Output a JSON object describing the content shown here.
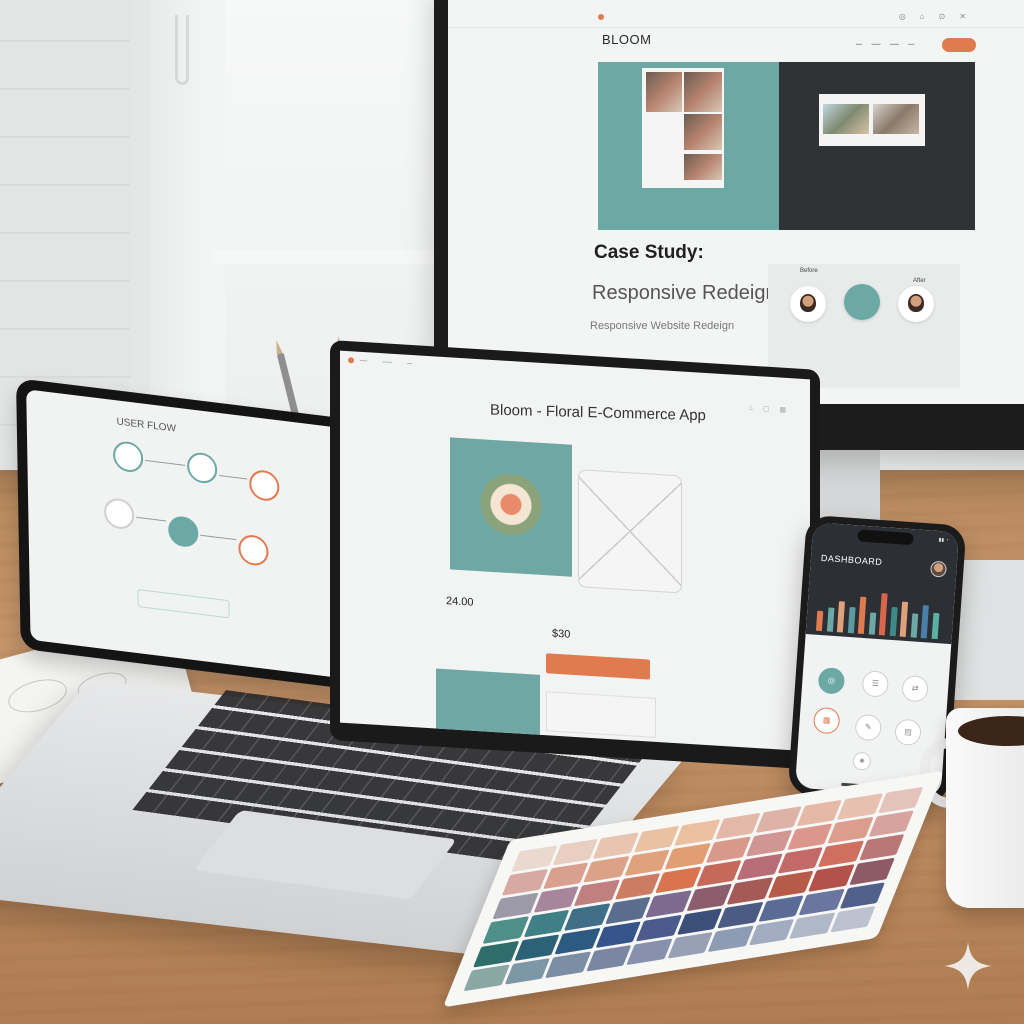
{
  "monitor": {
    "brand": "BLOOM",
    "case_title": "Case Study:",
    "case_subtitle": "Responsive Redeign",
    "case_subtitle2": "Responsive Website Redeign",
    "before_label": "Before",
    "after_label": "After"
  },
  "laptop": {
    "app_title": "Bloom - Floral E-Commerce App",
    "price_a": "24.00",
    "price_b": "$30"
  },
  "tablet": {
    "title": "USER FLOW"
  },
  "phone": {
    "title": "DASHBOARD",
    "chart_bars": [
      {
        "value": 0.45,
        "color": "#e07a4f"
      },
      {
        "value": 0.55,
        "color": "#6ca9a5"
      },
      {
        "value": 0.7,
        "color": "#e0a07a"
      },
      {
        "value": 0.6,
        "color": "#5a9aa0"
      },
      {
        "value": 0.85,
        "color": "#e07a4f"
      },
      {
        "value": 0.5,
        "color": "#6ca9a5"
      },
      {
        "value": 0.95,
        "color": "#d9654a"
      },
      {
        "value": 0.65,
        "color": "#3f8a86"
      },
      {
        "value": 0.8,
        "color": "#e0a07a"
      },
      {
        "value": 0.55,
        "color": "#6ca9a5"
      },
      {
        "value": 0.75,
        "color": "#4a7fa8"
      },
      {
        "value": 0.6,
        "color": "#5ab0a4"
      }
    ]
  },
  "swatches": [
    "#e9d9cf",
    "#e8cfc2",
    "#e7c5b1",
    "#e9c2a4",
    "#eac0a1",
    "#e4b8a8",
    "#ddb3a8",
    "#e6b9a7",
    "#e8c0b0",
    "#e4c3ba",
    "#d7a9a3",
    "#d9a08f",
    "#dba287",
    "#e0a27b",
    "#e39d72",
    "#d8998a",
    "#d09792",
    "#db978b",
    "#dd9d8e",
    "#d6a39e",
    "#9b9aa6",
    "#a7869b",
    "#c0807f",
    "#cd7c64",
    "#d8744f",
    "#c5695a",
    "#b86d76",
    "#c46a66",
    "#cf6f5f",
    "#b97777",
    "#4f8f8a",
    "#3f7f86",
    "#3f6e86",
    "#5b6d8f",
    "#7c6b8f",
    "#8c5d6d",
    "#a65a57",
    "#b65b48",
    "#b3524a",
    "#8d5a66",
    "#2f6d6b",
    "#2c6275",
    "#2d5a80",
    "#36548a",
    "#4a5b8c",
    "#3c4f78",
    "#4b5b84",
    "#5a6b96",
    "#6a75a0",
    "#51608b",
    "#8aa7a6",
    "#7d97a7",
    "#7b8ea4",
    "#7a86a2",
    "#8790ad",
    "#98a0b5",
    "#8d9bb3",
    "#a1acc0",
    "#b0b8c8",
    "#bcc2cf"
  ]
}
